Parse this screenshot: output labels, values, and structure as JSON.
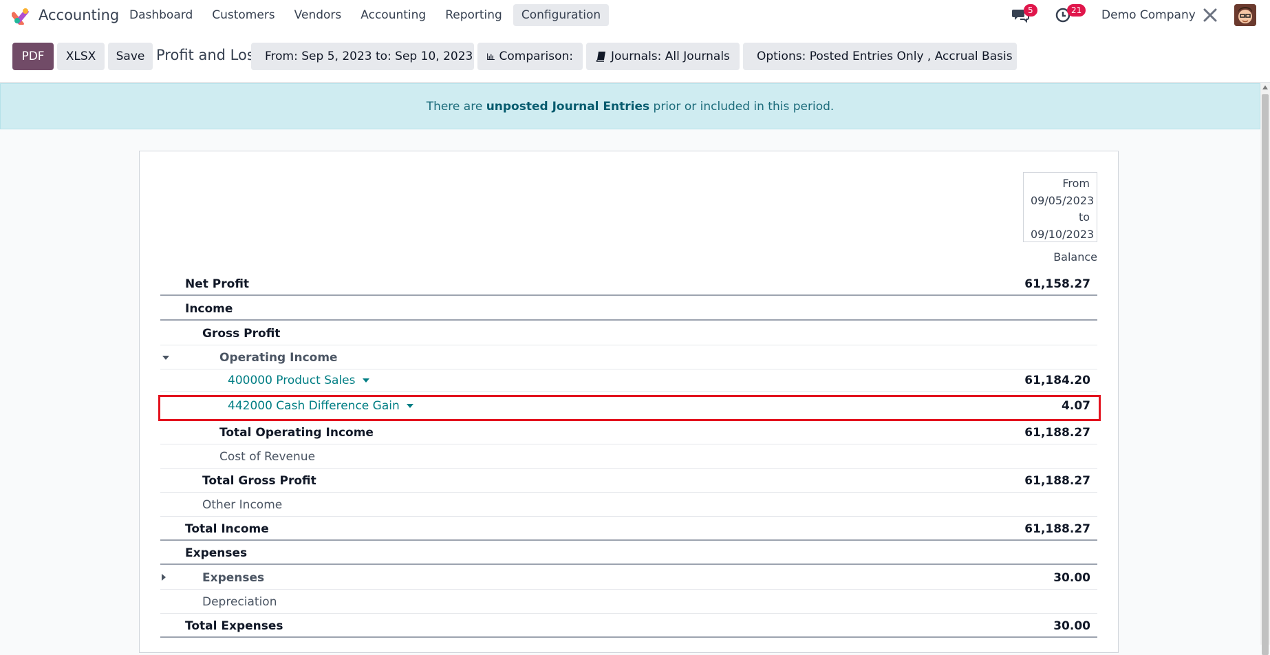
{
  "app": {
    "name": "Accounting",
    "menu": [
      "Dashboard",
      "Customers",
      "Vendors",
      "Accounting",
      "Reporting",
      "Configuration"
    ],
    "active_menu": "Configuration",
    "messages_count": "5",
    "activities_count": "21",
    "company": "Demo Company",
    "icons": [
      "app-logo-icon",
      "chat-icon",
      "clock-icon",
      "tools-icon",
      "avatar"
    ]
  },
  "control_panel": {
    "pdf_label": "PDF",
    "xlsx_label": "XLSX",
    "save_label": "Save",
    "report_title": "Profit and Loss",
    "date_filter": "From: Sep 5, 2023 to: Sep 10, 2023",
    "comparison_filter": "Comparison:",
    "journals_filter": "Journals: All Journals",
    "options_filter": "Options: Posted Entries Only , Accrual Basis"
  },
  "alert": {
    "prefix": "There are ",
    "link": "unposted Journal Entries",
    "suffix": " prior or included in this period."
  },
  "report": {
    "period": [
      "From",
      "09/05/2023",
      "to",
      "09/10/2023"
    ],
    "column_header": "Balance",
    "rows": [
      {
        "label": "Net Profit",
        "value": "61,158.27"
      },
      {
        "label": "Income",
        "value": ""
      },
      {
        "label": "Gross Profit",
        "value": ""
      },
      {
        "label": "Operating Income",
        "value": ""
      },
      {
        "label": "400000 Product Sales",
        "value": "61,184.20"
      },
      {
        "label": "442000 Cash Difference Gain",
        "value": "4.07"
      },
      {
        "label": "Total Operating Income",
        "value": "61,188.27"
      },
      {
        "label": "Cost of Revenue",
        "value": ""
      },
      {
        "label": "Total Gross Profit",
        "value": "61,188.27"
      },
      {
        "label": "Other Income",
        "value": ""
      },
      {
        "label": "Total Income",
        "value": "61,188.27"
      },
      {
        "label": "Expenses",
        "value": ""
      },
      {
        "label": "Expenses",
        "value": "30.00"
      },
      {
        "label": "Depreciation",
        "value": ""
      },
      {
        "label": "Total Expenses",
        "value": "30.00"
      }
    ]
  },
  "colors": {
    "brand": "#714b67",
    "link": "#017e84",
    "alert_bg": "#cfecf1",
    "highlight": "#e3131f",
    "badge": "#e0164b"
  }
}
